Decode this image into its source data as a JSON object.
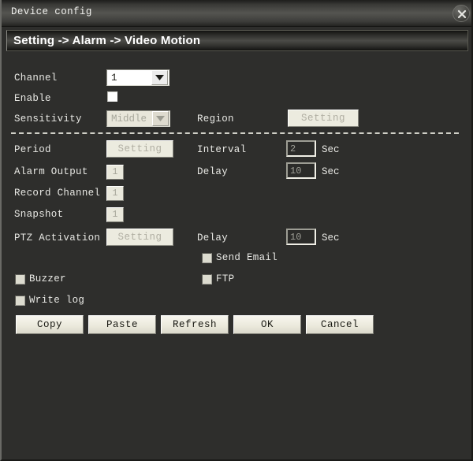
{
  "window": {
    "title": "Device config",
    "close_icon": "close-icon"
  },
  "header": {
    "breadcrumb": "Setting -> Alarm -> Video Motion"
  },
  "form": {
    "channel": {
      "label": "Channel",
      "value": "1",
      "enabled": true
    },
    "enable": {
      "label": "Enable",
      "checked": false
    },
    "sensitivity": {
      "label": "Sensitivity",
      "value": "Middle",
      "enabled": false
    },
    "region": {
      "label": "Region",
      "button_label": "Setting"
    },
    "period": {
      "label": "Period",
      "button_label": "Setting"
    },
    "interval": {
      "label": "Interval",
      "value": "2",
      "unit": "Sec"
    },
    "alarm_output": {
      "label": "Alarm Output",
      "value": "1"
    },
    "alarm_delay": {
      "label": "Delay",
      "value": "10",
      "unit": "Sec"
    },
    "record_channel": {
      "label": "Record Channel",
      "value": "1"
    },
    "snapshot": {
      "label": "Snapshot",
      "value": "1"
    },
    "ptz_activation": {
      "label": "PTZ Activation",
      "button_label": "Setting"
    },
    "ptz_delay": {
      "label": "Delay",
      "value": "10",
      "unit": "Sec"
    },
    "send_email": {
      "label": "Send Email",
      "checked": false
    },
    "buzzer": {
      "label": "Buzzer",
      "checked": false
    },
    "ftp": {
      "label": "FTP",
      "checked": false
    },
    "write_log": {
      "label": "Write log",
      "checked": false
    }
  },
  "buttons": {
    "copy": "Copy",
    "paste": "Paste",
    "refresh": "Refresh",
    "ok": "OK",
    "cancel": "Cancel"
  },
  "colors": {
    "window_bg": "#2e2e2c",
    "titlebar_mid": "#555551",
    "field_light": "#ecebdf",
    "text_light": "#e8e8e4",
    "disabled_text": "#a8a89c"
  }
}
